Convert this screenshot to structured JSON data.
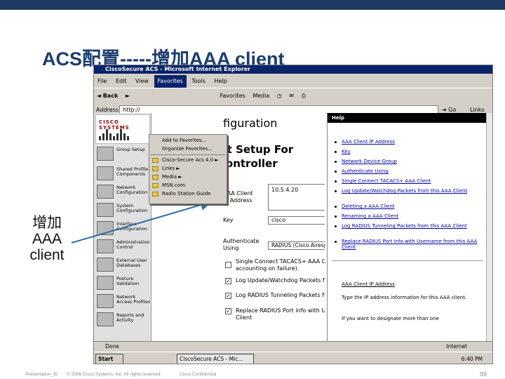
{
  "slide": {
    "title": "ACS配置-----增加AAA client",
    "side_label_1": "增加",
    "side_label_2": "AAA",
    "side_label_3": "client",
    "topbar_color": "#1f3b63"
  },
  "browser": {
    "title": "CiscoSecure ACS - Microsoft Internet Explorer",
    "menus": [
      "File",
      "Edit",
      "View",
      "Favorites",
      "Tools",
      "Help"
    ],
    "active_menu_index": 3,
    "toolbar": {
      "back": "Back",
      "favorites": "Favorites",
      "media": "Media"
    },
    "address_label": "Address",
    "address_value": "http://",
    "go": "Go",
    "links": "Links"
  },
  "favorites_menu": {
    "items": [
      "Add to Favorites...",
      "Organize Favorites...",
      "Cisco-Secure Acs 4.0",
      "Links",
      "Media",
      "MSN.com",
      "Radio Station Guide"
    ]
  },
  "nav": {
    "logo": "CISCO SYSTEMS",
    "items": [
      "Group Setup",
      "Shared Profile Components",
      "Network Configuration",
      "System Configuration",
      "Interface Configuration",
      "Administration Control",
      "External User Databases",
      "Posture Validation",
      "Network Access Profiles",
      "Reports and Activity"
    ]
  },
  "main": {
    "header": "figuration",
    "title_line1": "nt Setup For",
    "title_line2": "controller",
    "ip_label_1": "AAA Client",
    "ip_label_2": "IP Address",
    "ip_value": "10.5.4.20",
    "key_label": "Key",
    "key_value": "cisco",
    "auth_label_1": "Authenticate",
    "auth_label_2": "Using",
    "auth_value": "RADIUS (Cisco Airespace)",
    "checkboxes": [
      {
        "line1": "Single Connect TACACS+ AAA Client (Rec",
        "line2": "accounting on failure).",
        "checked": false
      },
      {
        "line1": "Log Update/Watchdog Packets from this A",
        "line2": "",
        "checked": true
      },
      {
        "line1": "Log RADIUS Tunneling Packets from this A",
        "line2": "",
        "checked": true
      },
      {
        "line1": "Replace RADIUS Port info with Username f",
        "line2": "Client",
        "checked": true
      }
    ]
  },
  "help": {
    "header": "Help",
    "links": [
      "AAA Client IP Address",
      "Key",
      "Network Device Group",
      "Authenticate Using",
      "Single Connect TACACS+ AAA Client",
      "Log Update/Watchdog Packets from this AAA Client",
      "Deleting a AAA Client",
      "Renaming a AAA Client",
      "Log RADIUS Tunneling Packets from this AAA Client",
      "Replace RADIUS Port info with Username from this AAA Client"
    ],
    "section_title": "AAA Client IP Address",
    "section_text_1": "Type the IP address information for this AAA client.",
    "section_text_2": "If you want to designate more than one"
  },
  "status": {
    "text": "Done",
    "zone": "Internet"
  },
  "taskbar": {
    "start": "Start",
    "app": "CiscoSecure ACS - Mic...",
    "clock": "6:40 PM"
  },
  "footer": {
    "presentation": "Presentation_ID",
    "copyright": "© 2006 Cisco Systems, Inc. All rights reserved.",
    "confidential": "Cisco Confidential",
    "page": "99"
  }
}
